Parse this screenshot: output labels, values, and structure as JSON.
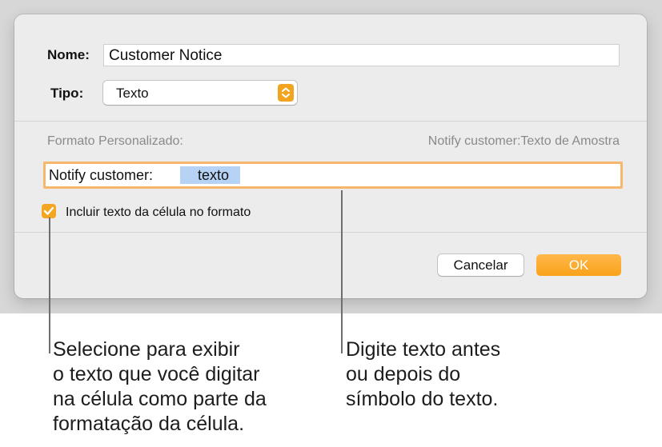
{
  "dialog": {
    "name_label": "Nome:",
    "name_value": "Customer Notice",
    "type_label": "Tipo:",
    "type_value": "Texto",
    "custom_format_label": "Formato Personalizado:",
    "preview_text": "Notify customer:Texto de Amostra",
    "format_prefix": "Notify customer:",
    "format_token": "texto",
    "checkbox_label": "Incluir texto da célula no formato",
    "checkbox_checked": true,
    "cancel_label": "Cancelar",
    "ok_label": "OK"
  },
  "callouts": {
    "left": "Selecione para exibir\no texto que você digitar\nna célula como parte da\nformatação da célula.",
    "right": "Digite texto antes\nou depois do\nsímbolo do texto."
  },
  "colors": {
    "accent": "#f9a21a",
    "token_highlight": "#b6d3f5",
    "focus_ring": "#f6b66e"
  },
  "icons": {
    "stepper": "chevron-up-down-icon",
    "checkbox": "checkmark-icon"
  }
}
